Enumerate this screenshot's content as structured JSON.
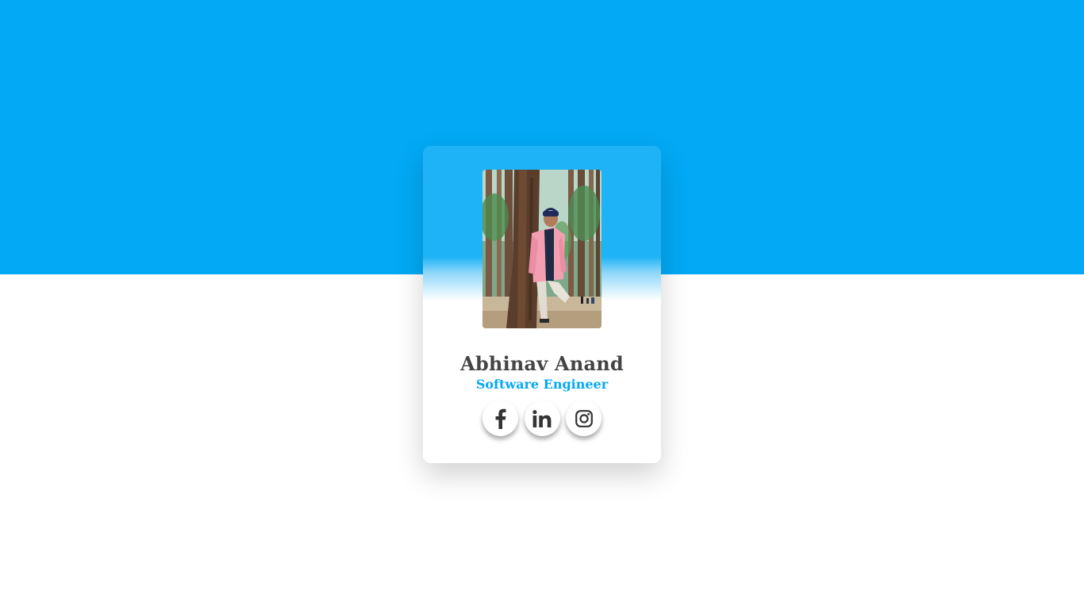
{
  "profile": {
    "name": "Abhinav Anand",
    "role": "Software Engineer",
    "photo_icon": "profile-photo"
  },
  "socials": [
    {
      "icon": "facebook-icon"
    },
    {
      "icon": "linkedin-icon"
    },
    {
      "icon": "instagram-icon"
    }
  ],
  "colors": {
    "accent": "#03a9f4",
    "card_top": "#1eb3f6",
    "name_text": "#444444",
    "icon": "#333333"
  }
}
